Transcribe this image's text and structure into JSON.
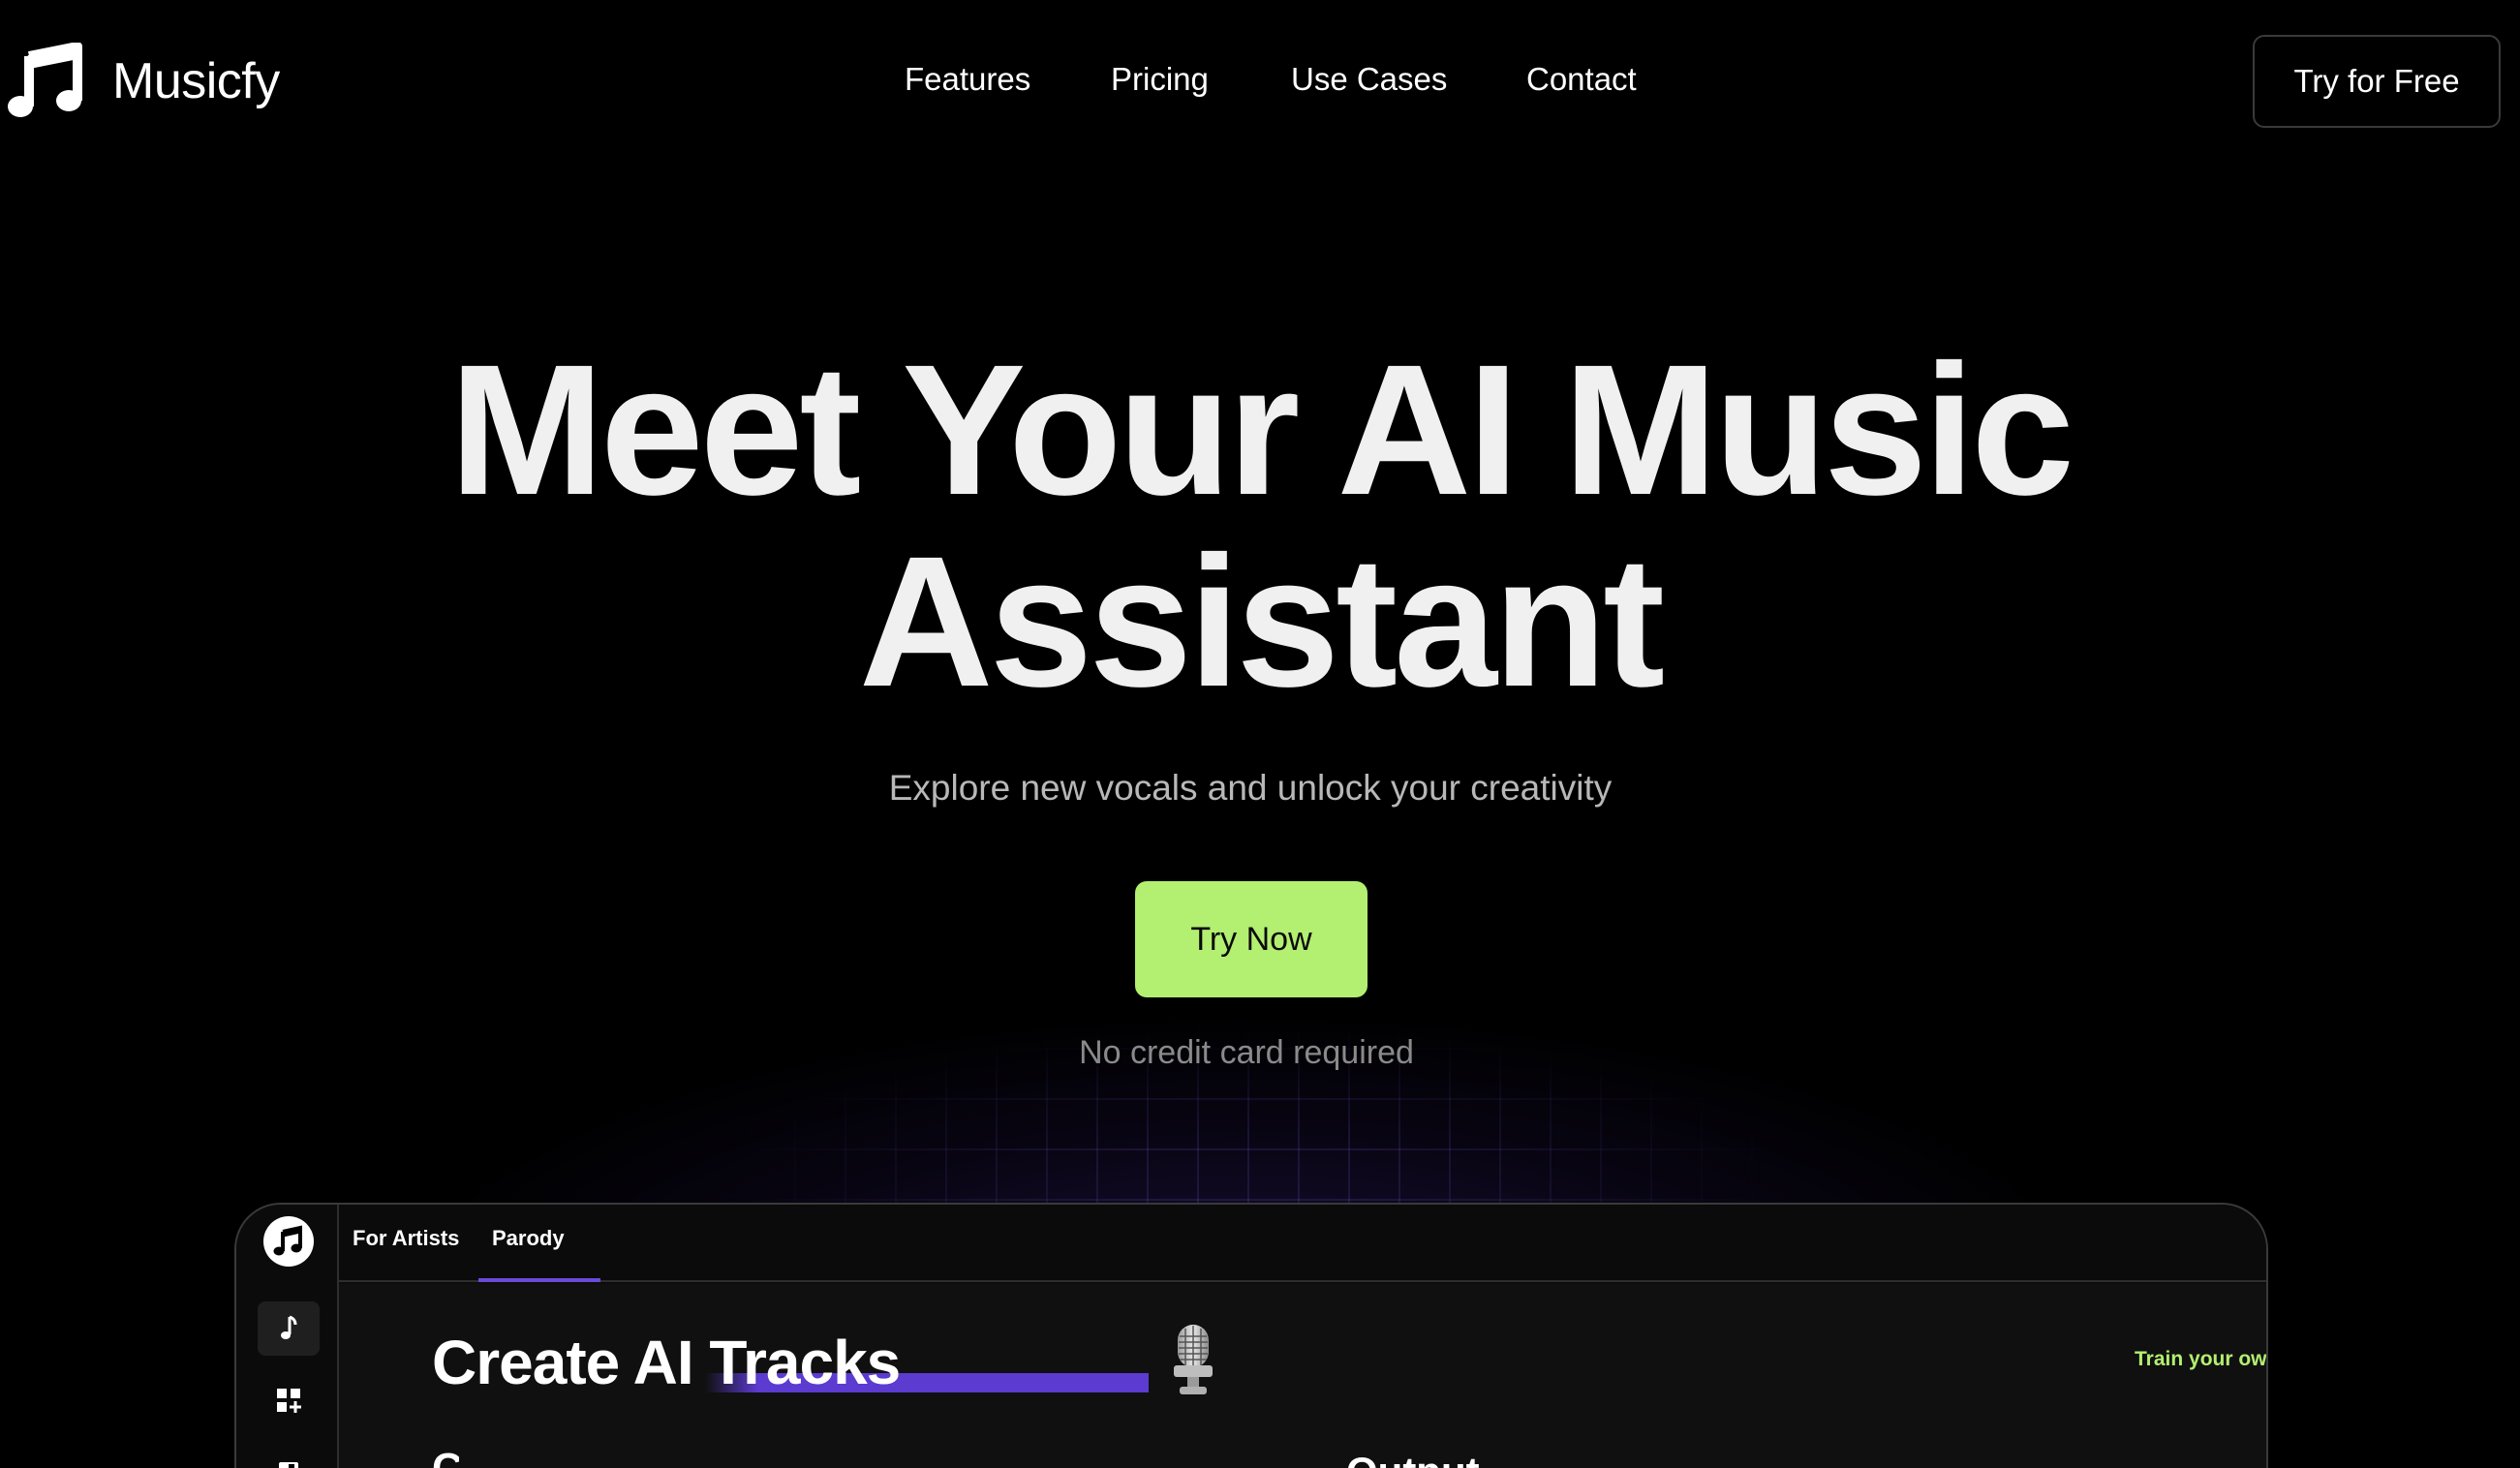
{
  "nav": {
    "brand": "Musicfy",
    "links": [
      "Features",
      "Pricing",
      "Use Cases",
      "Contact"
    ],
    "cta": "Try for Free"
  },
  "hero": {
    "title_line1": "Meet Your AI Music",
    "title_line2": "Assistant",
    "subtitle": "Explore new vocals and unlock your creativity",
    "cta": "Try Now",
    "note": "No credit card required"
  },
  "app_preview": {
    "tabs": [
      "For Artists",
      "Parody"
    ],
    "active_tab": "For Artists",
    "heading": "Create AI Tracks",
    "train_link": "Train your own AI Voice",
    "partial_left": "C",
    "partial_right": "Output"
  },
  "colors": {
    "accent_green": "#b3ef71",
    "accent_purple": "#5b3bd0",
    "background": "#000000"
  },
  "icons": [
    "music-note-logo-icon",
    "music-note-icon",
    "grid-plus-icon",
    "document-icon",
    "microphone-icon",
    "arrow-right-icon"
  ]
}
